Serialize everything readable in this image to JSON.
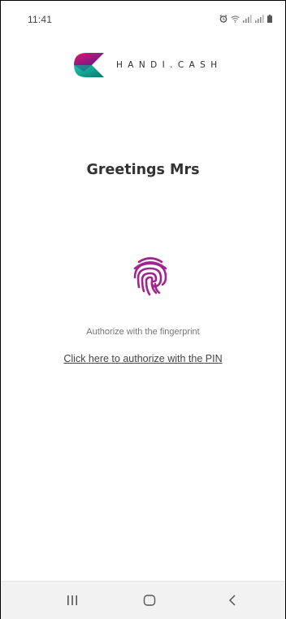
{
  "status_bar": {
    "time": "11:41",
    "icons": [
      "alarm-icon",
      "wifi-icon",
      "signal-icon",
      "signal-icon",
      "battery-icon"
    ]
  },
  "brand": {
    "name": "HANDI.CASH",
    "colors": {
      "magenta": "#c2185b",
      "purple": "#4a148c",
      "teal": "#1ab5a3",
      "dark_teal": "#00695c"
    }
  },
  "greeting": "Greetings Mrs",
  "fingerprint": {
    "icon": "fingerprint-icon",
    "color": "#a0258c"
  },
  "authorize_hint": "Authorize with the fingerprint",
  "pin_link": "Click here to authorize with the PIN",
  "nav_bar": {
    "buttons": [
      "recent-apps-icon",
      "home-icon",
      "back-icon"
    ]
  }
}
